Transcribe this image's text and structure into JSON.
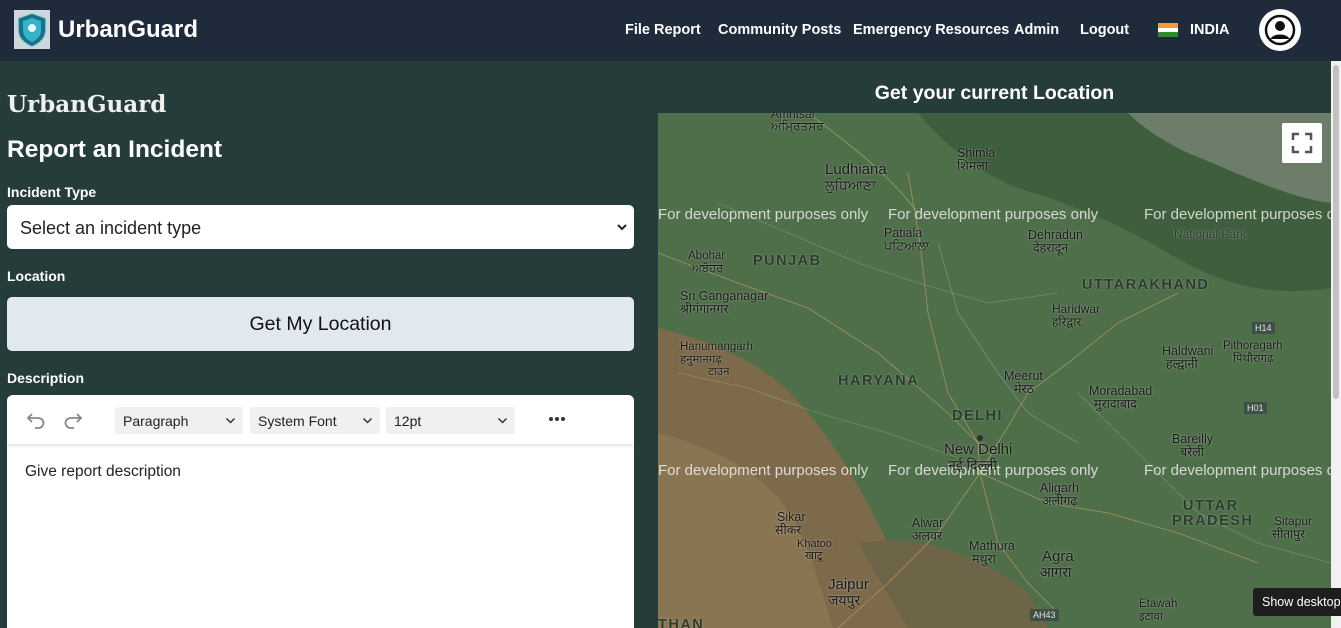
{
  "header": {
    "brand": "UrbanGuard",
    "nav": [
      "File Report",
      "Community Posts",
      "Emergency Resources",
      "Admin",
      "Logout"
    ],
    "country": "INDIA"
  },
  "form": {
    "brand": "UrbanGuard",
    "title": "Report an Incident",
    "incident_label": "Incident Type",
    "incident_placeholder": "Select an incident type",
    "location_label": "Location",
    "location_button": "Get My Location",
    "description_label": "Description",
    "editor": {
      "block_format": "Paragraph",
      "font_family": "System Font",
      "font_size": "12pt",
      "placeholder": "Give report description"
    }
  },
  "map": {
    "heading": "Get your current Location",
    "watermark": "For development purposes only",
    "states": [
      "PUNJAB",
      "HARYANA",
      "DELHI",
      "UTTARAKHAND",
      "UTTAR",
      "PRADESH"
    ],
    "cities": [
      "Amritsar",
      "ਅੰਮ੍ਰਿਤਸਰ",
      "Ludhiana",
      "ਲੁਧਿਆਣਾ",
      "Shimla",
      "शिमला",
      "Patiala",
      "ਪਟਿਆਲਾ",
      "Dehradun",
      "देहरादून",
      "Abohar",
      "ਅਬੋਹਰ",
      "Sri Ganganagar",
      "श्रीगंगानगर",
      "Haridwar",
      "हरिद्वार",
      "Hanumangarh",
      "हनुमानगढ़",
      "टाउन",
      "Haldwani",
      "हल्द्वानी",
      "Pithoragarh",
      "पिथौरागढ़",
      "Meerut",
      "मेरठ",
      "Moradabad",
      "मुरादाबाद",
      "New Delhi",
      "नई दिल्ली",
      "Bareilly",
      "बरेली",
      "Aligarh",
      "अलीगढ़",
      "Sitapur",
      "सीतापुर",
      "Sikar",
      "सीकर",
      "Alwar",
      "अलवर",
      "Khatoo",
      "खाटू",
      "Mathura",
      "मथुरा",
      "Agra",
      "आगरा",
      "Jaipur",
      "जयपुर",
      "Etawah",
      "इटावा",
      "National Park",
      "THAN"
    ],
    "road_labels": [
      "H14",
      "H01",
      "AH43"
    ]
  },
  "tooltip": "Show desktop",
  "colors": {
    "header_bg": "#1f2a3a",
    "panel_bg": "#263c3a",
    "button_bg": "#e2e8f0",
    "map_base": "#4f6e4a"
  },
  "icons": [
    "shield-logo-icon",
    "india-flag-icon",
    "user-avatar-icon",
    "chevron-down-icon",
    "undo-icon",
    "redo-icon",
    "more-icon",
    "fullscreen-icon"
  ]
}
